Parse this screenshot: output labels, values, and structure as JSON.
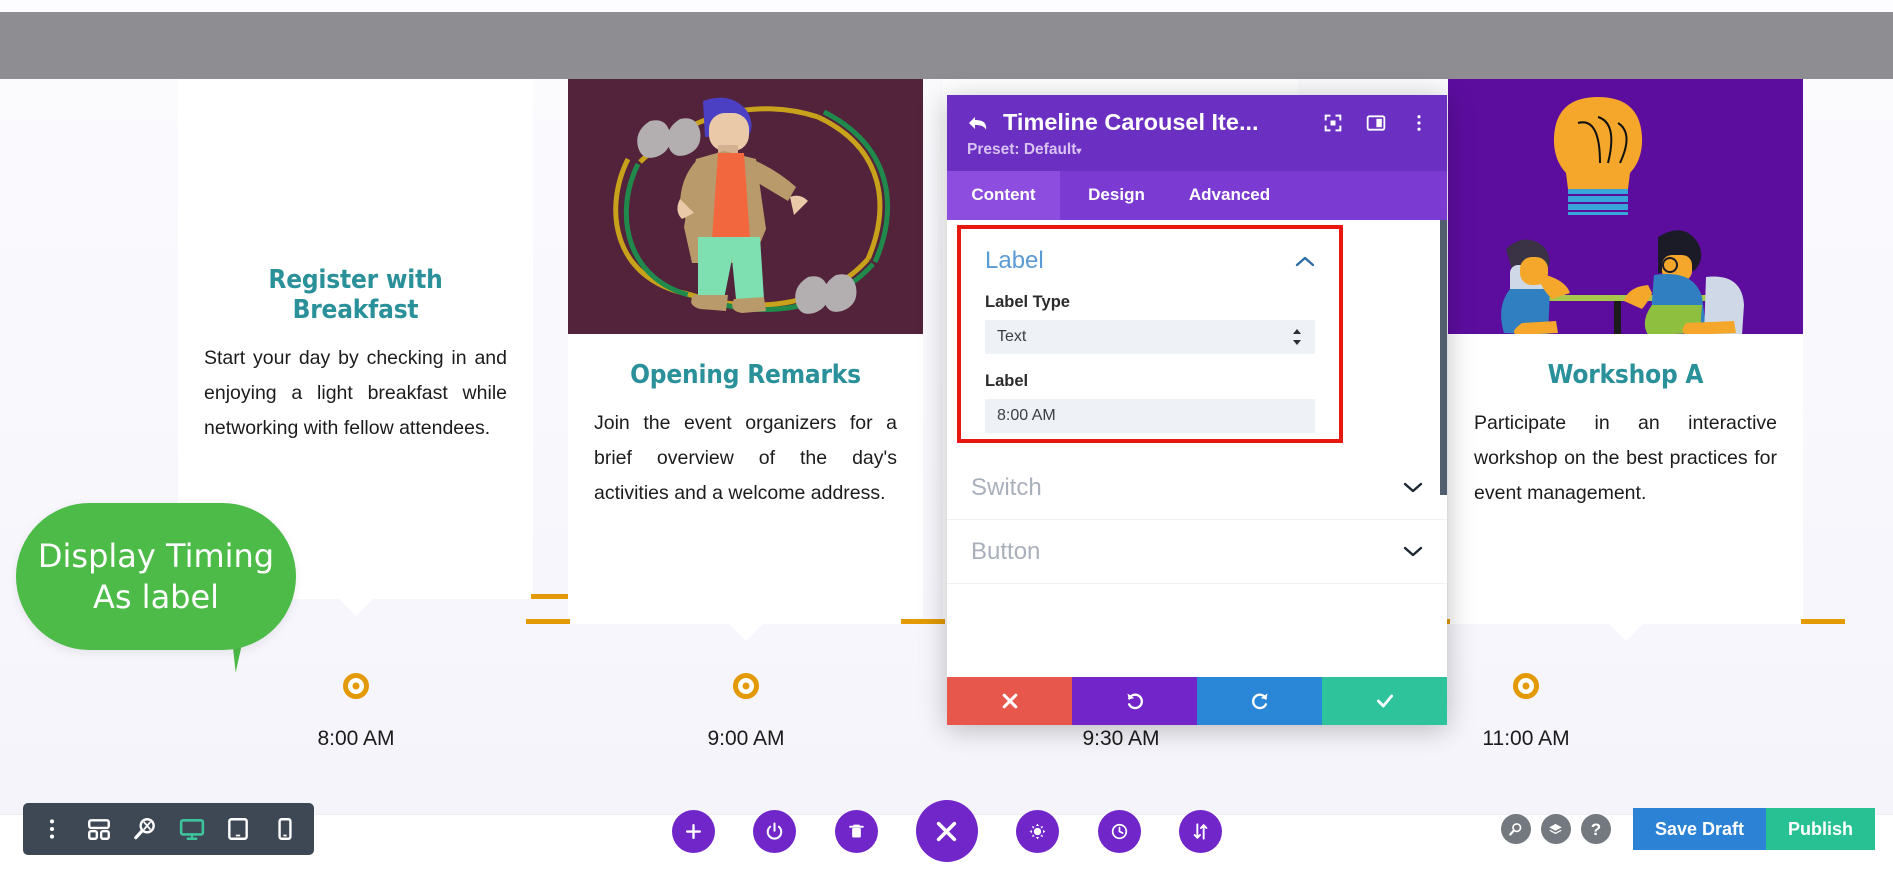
{
  "page": {
    "top_bar_color": "#8e8e92",
    "accent_teal": "#2a9099",
    "accent_orange": "#e39a06"
  },
  "carousel": {
    "cards": [
      {
        "title": "Register with Breakfast",
        "description": "Start your day by checking in and enjoying a light breakfast while networking with fellow attendees.",
        "time": "8:00 AM",
        "image": "none"
      },
      {
        "title": "Opening Remarks",
        "description": "Join the event organizers for a brief overview of the day's activities and a welcome address.",
        "time": "9:00 AM",
        "image": "speaker-illustration"
      },
      {
        "title": "",
        "description": "",
        "time": "9:30 AM",
        "image": "hidden-behind-modal"
      },
      {
        "title": "Workshop A",
        "description": "Participate in an interactive workshop on the best practices for event management.",
        "time": "11:00 AM",
        "image": "lightbulb-meeting-illustration"
      }
    ]
  },
  "callout": {
    "text": "Display Timing As label",
    "color": "#4cbb47"
  },
  "modal": {
    "title": "Timeline Carousel Ite...",
    "preset": "Preset: Default",
    "preset_caret": "▾",
    "tabs": [
      {
        "label": "Content",
        "active": true
      },
      {
        "label": "Design",
        "active": false
      },
      {
        "label": "Advanced",
        "active": false
      }
    ],
    "sections": [
      {
        "label": "Label",
        "open": true,
        "highlighted": true
      },
      {
        "label": "Switch",
        "open": false,
        "highlighted": false
      },
      {
        "label": "Button",
        "open": false,
        "highlighted": false
      }
    ],
    "fields": {
      "label_type_caption": "Label Type",
      "label_type_value": "Text",
      "label_caption": "Label",
      "label_value": "8:00 AM"
    },
    "footer_buttons": [
      {
        "name": "cancel",
        "icon": "close-icon",
        "color": "#e8574c"
      },
      {
        "name": "undo",
        "icon": "undo-icon",
        "color": "#7226c9"
      },
      {
        "name": "redo",
        "icon": "redo-icon",
        "color": "#2a87d8"
      },
      {
        "name": "save",
        "icon": "check-icon",
        "color": "#2ec39b"
      }
    ],
    "header_icons": [
      "expand-icon",
      "layout-icon",
      "more-vertical-icon"
    ],
    "scrollbar_color": "#505e6e"
  },
  "toolbars": {
    "left_icons": [
      "more-vertical-icon",
      "wireframe-icon",
      "zoom-icon",
      "desktop-icon",
      "tablet-icon",
      "mobile-icon"
    ],
    "left_active_icon": "desktop-icon",
    "center_icons": [
      "plus-icon",
      "power-icon",
      "trash-icon",
      "close-icon",
      "gear-icon",
      "history-icon",
      "sort-icon"
    ],
    "right_icons": [
      "search-icon",
      "layers-icon",
      "help-icon"
    ],
    "save_draft_label": "Save Draft",
    "publish_label": "Publish"
  }
}
